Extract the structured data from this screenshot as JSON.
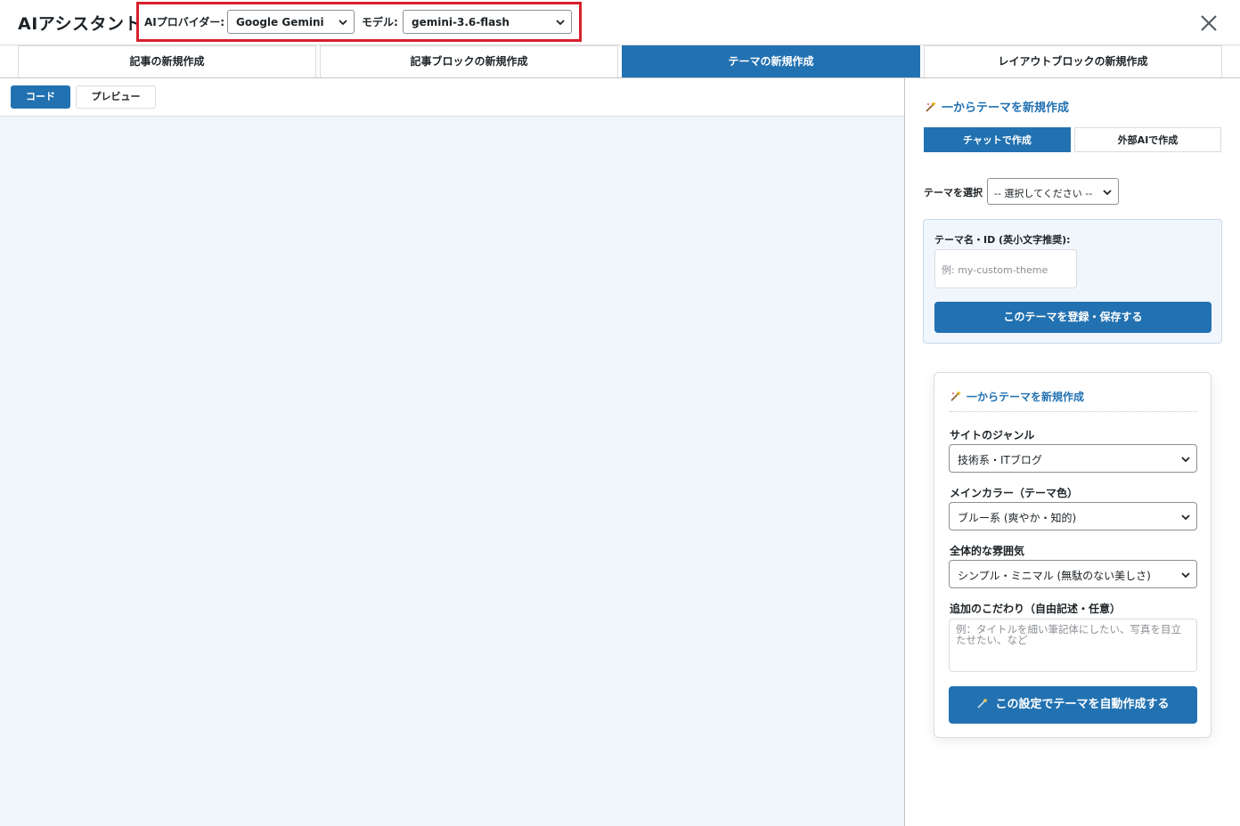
{
  "app": {
    "title": "AIアシスタント",
    "provider_label": "AIプロバイダー:",
    "provider_value": "Google Gemini",
    "model_label": "モデル:",
    "model_value": "gemini-3.6-flash",
    "close_icon": "close-icon",
    "highlight_color": "#d6202b"
  },
  "tabs": [
    {
      "label": "記事の新規作成",
      "active": false
    },
    {
      "label": "記事ブロックの新規作成",
      "active": false
    },
    {
      "label": "テーマの新規作成",
      "active": true
    },
    {
      "label": "レイアウトブロックの新規作成",
      "active": false
    }
  ],
  "editor": {
    "code_label": "コード",
    "preview_label": "プレビュー"
  },
  "sidebar": {
    "heading": "一からテーマを新規作成",
    "subtab_chat": "チャットで作成",
    "subtab_external": "外部AIで作成",
    "theme_select_label": "テーマを選択",
    "theme_select_value": "-- 選択してください --",
    "register": {
      "label": "テーマ名・ID (英小文字推奨):",
      "placeholder": "例: my-custom-theme",
      "button": "このテーマを登録・保存する"
    },
    "generator": {
      "title": "一からテーマを新規作成",
      "genre_label": "サイトのジャンル",
      "genre_value": "技術系・ITブログ",
      "color_label": "メインカラー（テーマ色）",
      "color_value": "ブルー系 (爽やか・知的)",
      "mood_label": "全体的な雰囲気",
      "mood_value": "シンプル・ミニマル (無駄のない美しさ)",
      "extra_label": "追加のこだわり（自由記述・任意）",
      "extra_placeholder": "例：タイトルを細い筆記体にしたい、写真を目立たせたい、など",
      "button": "この設定でテーマを自動作成する"
    }
  },
  "colors": {
    "accent": "#2271b1",
    "canvas": "#f0f6fc"
  }
}
